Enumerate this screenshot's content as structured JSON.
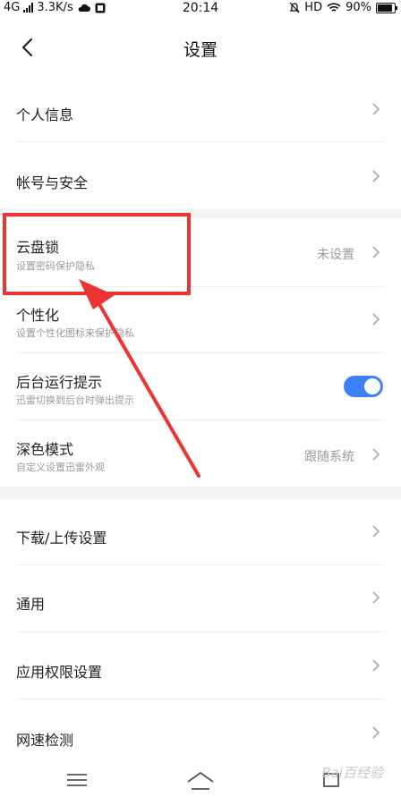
{
  "status_bar": {
    "network": "4G",
    "speed": "3.3K/s",
    "time": "20:14",
    "hd": "HD",
    "battery": "90%"
  },
  "header": {
    "title": "设置"
  },
  "rows": {
    "personal_info": {
      "label": "个人信息"
    },
    "account_security": {
      "label": "帐号与安全"
    },
    "cloud_lock": {
      "label": "云盘锁",
      "subtitle": "设置密码保护隐私",
      "value": "未设置"
    },
    "personalization": {
      "label": "个性化",
      "subtitle": "设置个性化图标来保护隐私"
    },
    "background_tip": {
      "label": "后台运行提示",
      "subtitle": "迅雷切换到后台时弹出提示",
      "enabled": true
    },
    "dark_mode": {
      "label": "深色模式",
      "subtitle": "自定义设置迅雷外观",
      "value": "跟随系统"
    },
    "transfer_settings": {
      "label": "下载/上传设置"
    },
    "general": {
      "label": "通用"
    },
    "app_permissions": {
      "label": "应用权限设置"
    },
    "speed_test": {
      "label": "网速检测"
    }
  },
  "watermark": "Bai百经验",
  "colors": {
    "accent": "#3d7ff5",
    "highlight": "#ee3333"
  }
}
